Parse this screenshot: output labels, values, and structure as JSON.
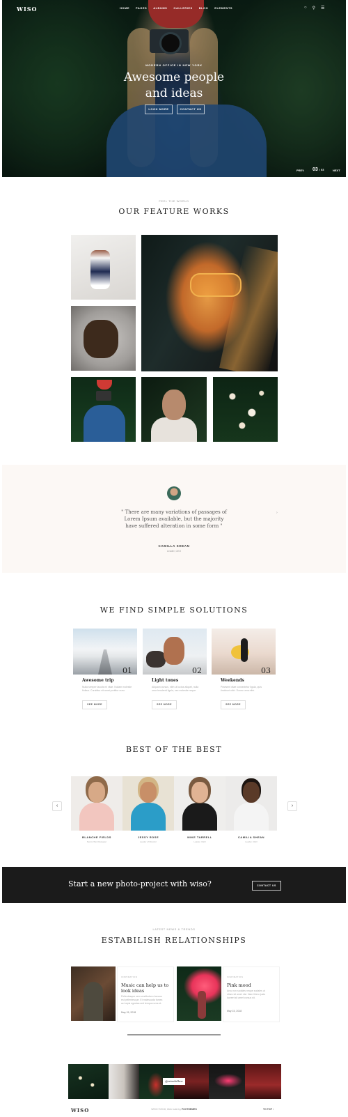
{
  "header": {
    "logo": "WISO",
    "nav": [
      "HOME",
      "PAGES",
      "ALBUMS",
      "GALLERIES",
      "BLOG",
      "ELEMENTS"
    ],
    "icons": [
      "bag-icon",
      "search-icon",
      "menu-icon"
    ]
  },
  "hero": {
    "eyebrow": "MODERN OFFICE IN NEW YORK",
    "title_line1": "Awesome people",
    "title_line2": "and ideas",
    "btn_primary": "LOOK MORE",
    "btn_secondary": "CONTACT US",
    "prev": "PREV",
    "slide_current": "03",
    "slide_total": "/ 03",
    "next": "NEXT"
  },
  "works": {
    "kicker": "FEEL THE WORLD",
    "title": "OUR FEATURE WORKS"
  },
  "testimonial": {
    "quote": "\" There are many variations of passages of Lorem Ipsum available, but the majority have suffered alteration in some form \"",
    "name": "CAMILLA SHEAN",
    "role": "Leader, CEO"
  },
  "solutions": {
    "title": "WE FIND SIMPLE SOLUTIONS",
    "cards": [
      {
        "number": "01",
        "title": "Awesome trip",
        "text": "Nulla semper iaculis mi vitae. Nullam molestie finibus. Curabitur sit amet porttitor nunc.",
        "button": "SEE MORE"
      },
      {
        "number": "02",
        "title": "Light tones",
        "text": "Aliquam cursus, nibh ut luctus aliquet, nulla urna hendrerit ligula, nec molestie neque.",
        "button": "SEE MORE"
      },
      {
        "number": "03",
        "title": "Weekends",
        "text": "Praesent vitae consectetur ligula, quis tincidunt nibh. Donec urna nibh.",
        "button": "SEE MORE"
      }
    ]
  },
  "team": {
    "title": "BEST OF THE BEST",
    "members": [
      {
        "name": "BLANCHE FIELDS",
        "role": "Senior Web Designer"
      },
      {
        "name": "JESSY ROSE",
        "role": "Leader of Director"
      },
      {
        "name": "MIKE TARRELL",
        "role": "Leader, CEO"
      },
      {
        "name": "CAMILIA SHEAN",
        "role": "Leader, CEO"
      }
    ]
  },
  "cta": {
    "text": "Start a new photo-project with wiso?",
    "button": "CONTACT US"
  },
  "blog": {
    "kicker": "LATEST NEWS & TRENDS",
    "title": "ESTABILISH RELATIONSHIPS",
    "posts": [
      {
        "category": "INSPIRATION",
        "title_line1": "Music can help us to",
        "title_line2": "look ideas",
        "text": "Pellentesque sem vestibulum rhoncus est pellentesque. Et malesuada fames ac turpis egestas sed tempus urna et.",
        "date": "May 15, 2018"
      },
      {
        "category": "INSPIRATION",
        "title_line1": "Pink mood",
        "title_line2": "",
        "text": "Arcu non sodales neque sodales ut etiam sit amet nisl. Nam libero justo laoreet sit amet cursus sit.",
        "date": "May 15, 2018"
      }
    ]
  },
  "instagram": {
    "button": "@wisofollow"
  },
  "footer": {
    "logo": "WISO",
    "copyright_prefix": "WISO ©2018, Web build by",
    "copyright_brand": "FOXTHEMES",
    "to_top": "TO TOP"
  }
}
